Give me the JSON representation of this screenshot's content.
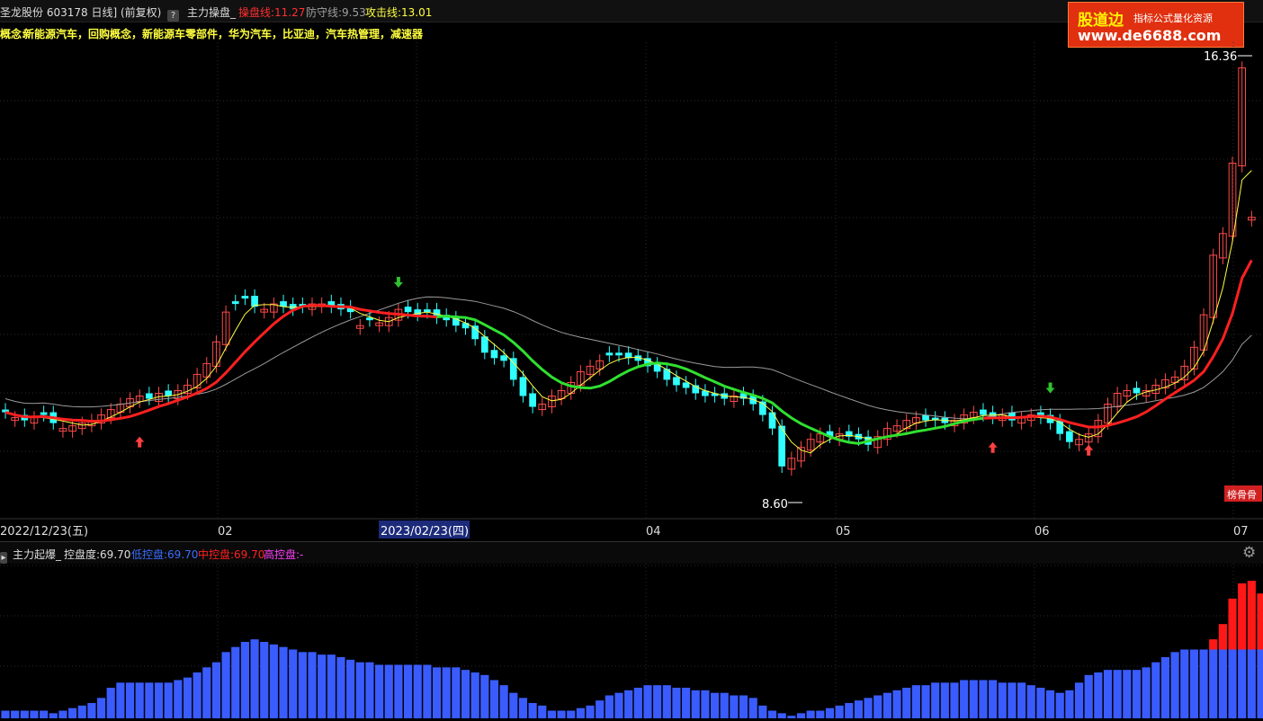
{
  "header": {
    "stock_name_code": "圣龙股份 603178 日线]",
    "adjust_label": "(前复权)",
    "help_icon": "?",
    "indicator_name": "主力操盘_",
    "line1_label": "操盘线:11.27",
    "line2_label": "防守线:9.53",
    "line3_label": "攻击线:13.01",
    "colors": {
      "line1": "#ff3030",
      "line2": "#a0a0a0",
      "line3": "#ffff40"
    }
  },
  "concepts": {
    "label": "概念:",
    "text": "新能源汽车，回购概念，新能源车零部件，华为汽车，比亚迪，汽车热管理，减速器"
  },
  "logo": {
    "brand": "股道边",
    "slogan": "指标公式量化资源",
    "url": "www.de6688.com"
  },
  "price_chart": {
    "high_label": "16.36",
    "low_label": "8.60",
    "badge": "榜骨骨",
    "x_labels": [
      "2022/12/23(五)",
      "02",
      "2023/02/23(四)",
      "04",
      "05",
      "06",
      "07"
    ],
    "highlight_date": "2023/02/23(四)"
  },
  "sub_indicator": {
    "name": "主力起爆_",
    "control_label": "控盘度:69.70",
    "low_label": "低控盘:69.70",
    "mid_label": "中控盘:69.70",
    "high_label": "高控盘:-",
    "gear_icon": "gear-icon",
    "colors": {
      "low": "#3a5cff",
      "mid": "#ff2020",
      "high": "#ff40ff"
    }
  },
  "chart_data": {
    "type": "candlestick",
    "closes": [
      10.0,
      9.9,
      9.85,
      9.9,
      9.95,
      9.8,
      9.7,
      9.75,
      9.8,
      9.85,
      9.95,
      10.05,
      10.15,
      10.25,
      10.3,
      10.25,
      10.35,
      10.3,
      10.4,
      10.5,
      10.7,
      10.9,
      11.3,
      11.85,
      12.0,
      12.1,
      11.95,
      11.9,
      12.0,
      11.95,
      11.9,
      11.95,
      12.0,
      12.0,
      11.95,
      11.9,
      11.85,
      11.6,
      11.7,
      11.65,
      11.75,
      11.9,
      11.85,
      11.8,
      11.85,
      11.75,
      11.7,
      11.6,
      11.55,
      11.35,
      11.1,
      11.0,
      10.95,
      10.6,
      10.3,
      10.1,
      10.15,
      10.3,
      10.4,
      10.55,
      10.75,
      10.85,
      10.95,
      11.05,
      11.05,
      11.0,
      10.95,
      10.85,
      10.75,
      10.6,
      10.5,
      10.45,
      10.35,
      10.3,
      10.3,
      10.25,
      10.3,
      10.25,
      10.15,
      9.95,
      9.7,
      9.0,
      9.15,
      9.35,
      9.5,
      9.6,
      9.55,
      9.6,
      9.55,
      9.5,
      9.4,
      9.55,
      9.7,
      9.75,
      9.85,
      9.9,
      9.85,
      9.85,
      9.8,
      9.85,
      9.95,
      10.0,
      9.95,
      9.9,
      9.95,
      9.85,
      9.9,
      9.95,
      9.9,
      9.8,
      9.6,
      9.45,
      9.5,
      9.6,
      9.85,
      10.15,
      10.35,
      10.4,
      10.35,
      10.4,
      10.5,
      10.6,
      10.65,
      10.85,
      11.2,
      11.8,
      12.9,
      13.3,
      14.6,
      16.36,
      13.6
    ],
    "up": [
      false,
      true,
      false,
      true,
      false,
      false,
      true,
      true,
      true,
      true,
      true,
      true,
      true,
      true,
      true,
      false,
      true,
      false,
      true,
      true,
      true,
      true,
      true,
      true,
      false,
      false,
      false,
      true,
      true,
      false,
      false,
      false,
      true,
      true,
      false,
      false,
      false,
      true,
      false,
      true,
      true,
      true,
      false,
      false,
      false,
      false,
      false,
      false,
      false,
      false,
      false,
      false,
      false,
      false,
      false,
      false,
      true,
      true,
      true,
      true,
      true,
      true,
      true,
      false,
      false,
      false,
      false,
      false,
      false,
      false,
      false,
      false,
      false,
      false,
      false,
      false,
      true,
      false,
      false,
      false,
      false,
      false,
      true,
      true,
      true,
      true,
      false,
      true,
      false,
      false,
      false,
      true,
      true,
      true,
      true,
      true,
      false,
      false,
      false,
      true,
      true,
      true,
      false,
      false,
      true,
      false,
      true,
      true,
      false,
      false,
      false,
      false,
      true,
      true,
      true,
      true,
      true,
      true,
      false,
      true,
      true,
      true,
      true,
      true,
      true,
      true,
      true,
      true,
      true,
      true,
      true,
      false
    ],
    "ma_red": [
      9.8,
      9.8,
      9.8,
      9.8,
      9.8,
      9.8,
      9.8,
      9.8,
      9.8,
      9.8,
      9.8,
      9.8,
      9.85,
      9.9,
      9.95,
      10.0,
      10.1,
      10.15,
      10.2,
      10.3,
      10.4,
      10.55,
      10.7,
      10.85,
      11.0,
      11.1,
      11.15,
      11.2,
      11.25,
      11.3,
      11.35,
      11.4,
      11.45,
      11.5,
      11.5,
      11.5,
      11.5,
      11.5,
      11.5,
      11.55,
      11.6,
      11.6,
      11.6,
      11.6,
      11.6,
      11.6
    ],
    "ma_green": [
      11.6,
      11.6,
      11.55,
      11.5,
      11.45,
      11.4,
      11.3,
      11.2,
      11.1,
      11.0,
      10.95,
      10.9,
      10.85,
      10.8,
      10.75,
      10.7,
      10.7,
      10.7,
      10.7,
      10.75,
      10.8,
      10.8,
      10.8,
      10.75,
      10.7,
      10.65,
      10.6,
      10.55,
      10.5,
      10.45,
      10.4,
      10.35,
      10.3,
      10.25,
      10.2,
      10.1,
      10.0,
      9.95,
      9.9,
      9.85,
      9.8,
      9.75,
      9.7,
      9.7,
      9.7,
      9.75,
      9.8,
      9.85,
      9.9,
      9.9,
      9.9,
      9.9,
      9.9,
      9.85,
      9.8,
      9.75,
      9.7,
      9.7
    ],
    "ylim": [
      8.2,
      16.7
    ],
    "sub_values": [
      3,
      3,
      3,
      3,
      3,
      2,
      3,
      4,
      5,
      6,
      8,
      12,
      14,
      14,
      14,
      14,
      14,
      14,
      15,
      16,
      18,
      20,
      22,
      26,
      28,
      30,
      31,
      30,
      29,
      28,
      27,
      26,
      26,
      25,
      25,
      24,
      23,
      22,
      22,
      21,
      21,
      21,
      21,
      21,
      21,
      20,
      20,
      20,
      19,
      18,
      17,
      15,
      13,
      10,
      8,
      6,
      5,
      3,
      3,
      3,
      4,
      5,
      7,
      9,
      10,
      11,
      12,
      13,
      13,
      13,
      12,
      12,
      11,
      11,
      10,
      10,
      9,
      9,
      8,
      5,
      3,
      2,
      1,
      2,
      3,
      3,
      4,
      5,
      6,
      7,
      8,
      9,
      10,
      11,
      12,
      13,
      13,
      14,
      14,
      14,
      15,
      15,
      15,
      15,
      14,
      14,
      14,
      13,
      12,
      11,
      10,
      11,
      14,
      17,
      18,
      19,
      19,
      19,
      19,
      20,
      22,
      24,
      26,
      27,
      27,
      27,
      27,
      27,
      27,
      27,
      27,
      27
    ],
    "sub_red_extra": [
      0,
      0,
      0,
      0,
      4,
      10,
      20,
      26,
      27,
      22
    ],
    "sub_ylim": [
      0,
      60
    ]
  }
}
